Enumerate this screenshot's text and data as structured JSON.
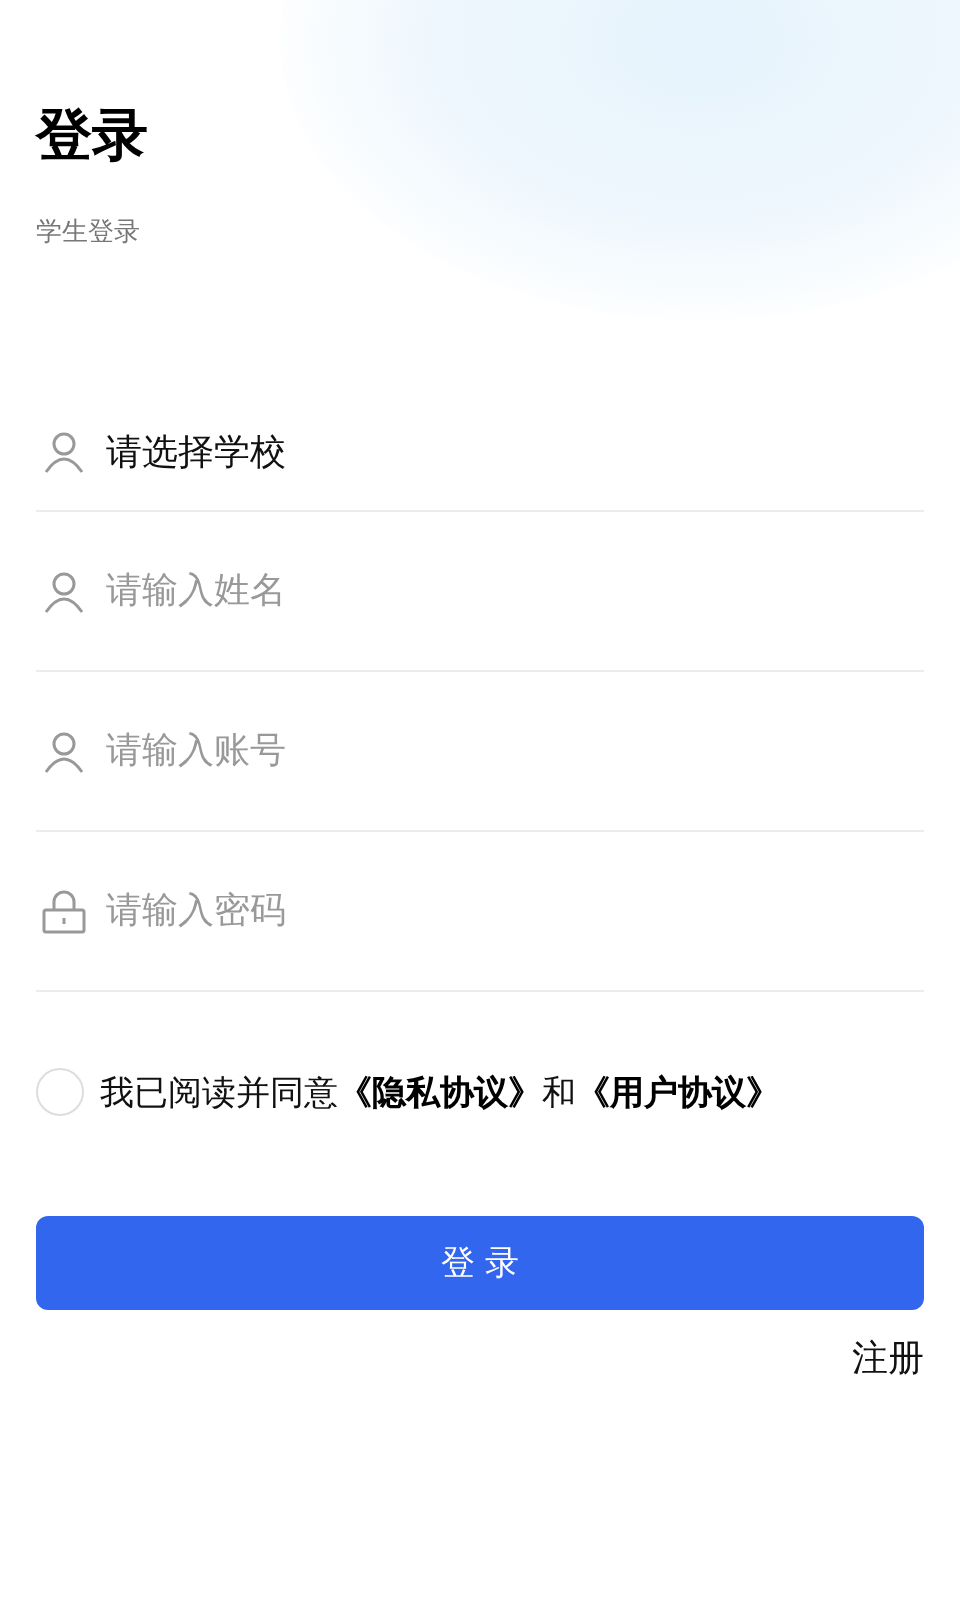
{
  "title": "登录",
  "subtitle": "学生登录",
  "fields": [
    {
      "kind": "user",
      "value": "请选择学校"
    },
    {
      "kind": "user",
      "placeholder": "请输入姓名"
    },
    {
      "kind": "user",
      "placeholder": "请输入账号"
    },
    {
      "kind": "lock",
      "placeholder": "请输入密码"
    }
  ],
  "agreement": {
    "checked": false,
    "parts": [
      {
        "kind": "text",
        "text": "我已阅读并同意"
      },
      {
        "kind": "link",
        "text": "《隐私协议》"
      },
      {
        "kind": "text",
        "text": "和"
      },
      {
        "kind": "link",
        "text": "《用户协议》"
      }
    ]
  },
  "login_button": "登 录",
  "register_link": "注册"
}
